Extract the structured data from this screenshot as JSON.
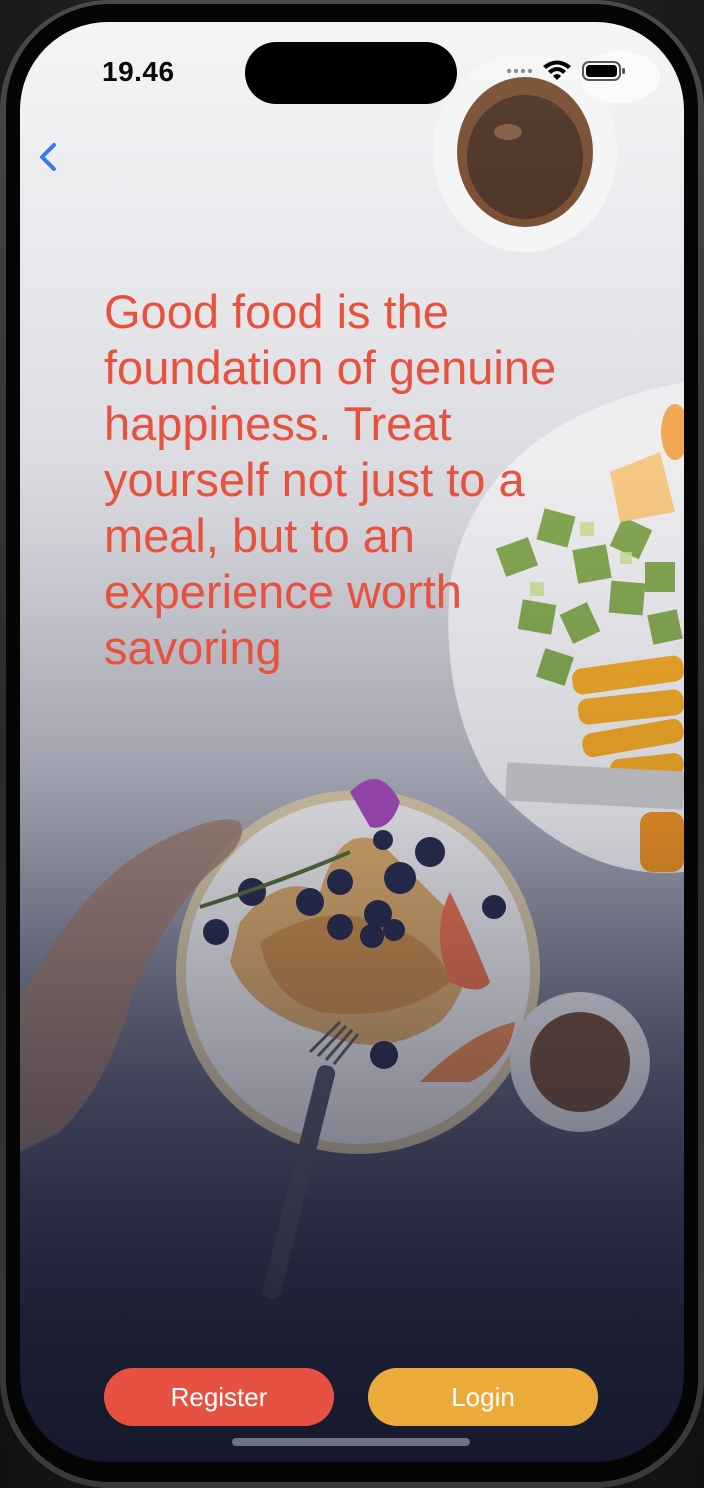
{
  "status_bar": {
    "time": "19.46",
    "icons": [
      "cellular-dots-icon",
      "wifi-icon",
      "battery-icon"
    ]
  },
  "nav": {
    "back_icon": "chevron-left-icon"
  },
  "main": {
    "quote": "Good food is the foundation of genuine happiness. Treat yourself not just to a meal, but to an experience worth savoring",
    "background_image": "food-flatlay-image"
  },
  "actions": {
    "register_label": "Register",
    "login_label": "Login"
  },
  "colors": {
    "quote": "#e8513e",
    "register": "#e65141",
    "login": "#ecaa3b",
    "back": "#3478f6"
  }
}
